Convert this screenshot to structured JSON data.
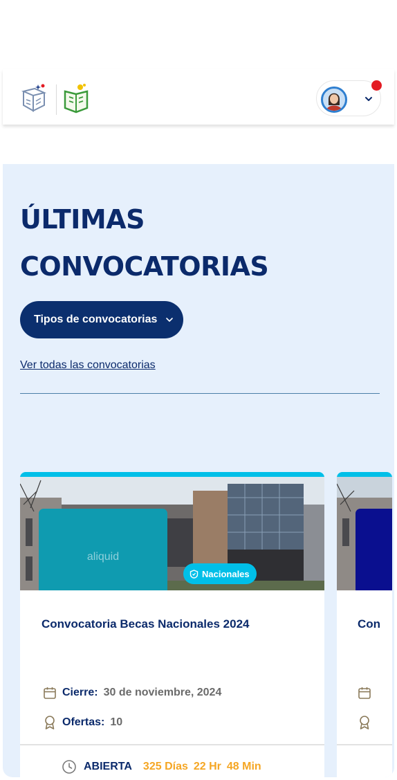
{
  "header": {
    "logo1_name": "ministry-logo",
    "logo2_name": "education-logo",
    "user_menu": {
      "avatar": "user-avatar",
      "chevron": "chevron-down-icon",
      "notification": "notification-dot"
    }
  },
  "section": {
    "title_line1": "ÚLTIMAS",
    "title_line2": "CONVOCATORIAS",
    "types_button": "Tipos de convocatorias",
    "see_all_link": "Ver todas las convocatorias"
  },
  "cards": [
    {
      "thumb_text": "aliquid",
      "badge": "Nacionales",
      "title": "Convocatoria Becas Nacionales 2024",
      "closing_label": "Cierre:",
      "closing_value": "30 de noviembre, 2024",
      "offers_label": "Ofertas:",
      "offers_value": "10",
      "status": "ABIERTA",
      "days": "325 Días",
      "hours": "22 Hr",
      "minutes": "48 Min"
    },
    {
      "title_fragment": "Con"
    }
  ],
  "colors": {
    "primary": "#0b2a6b",
    "button": "#0b2f6e",
    "accent": "#00bfe8",
    "countdown": "#f5a623",
    "section_bg": "#e6f0fc",
    "notification": "#e31b23"
  }
}
